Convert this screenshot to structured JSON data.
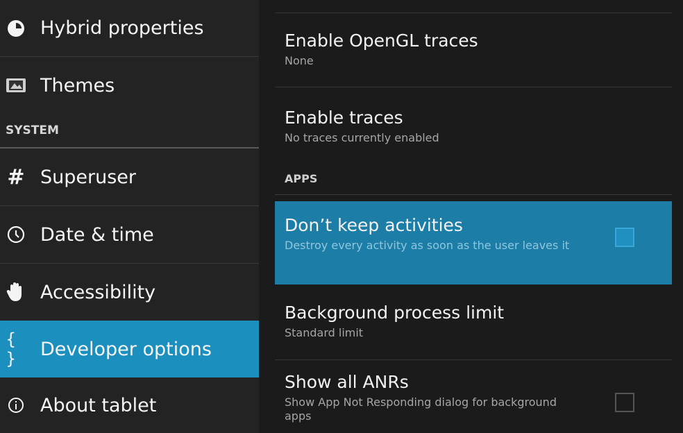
{
  "sidebar": {
    "items_top": [
      {
        "label": "Hybrid properties",
        "icon": "hybrid-icon"
      },
      {
        "label": "Themes",
        "icon": "themes-icon"
      }
    ],
    "section_system": "SYSTEM",
    "items_system": [
      {
        "label": "Superuser",
        "icon": "hash-icon"
      },
      {
        "label": "Date & time",
        "icon": "clock-icon"
      },
      {
        "label": "Accessibility",
        "icon": "hand-icon"
      },
      {
        "label": "Developer options",
        "icon": "braces-icon",
        "active": true
      },
      {
        "label": "About tablet",
        "icon": "info-icon"
      }
    ]
  },
  "main": {
    "prefs_top": [
      {
        "title": "Enable OpenGL traces",
        "summary": "None"
      },
      {
        "title": "Enable traces",
        "summary": "No traces currently enabled"
      }
    ],
    "section_apps": "APPS",
    "prefs_apps": [
      {
        "title": "Don’t keep activities",
        "summary": "Destroy every activity as soon as the user leaves it",
        "checked": false,
        "highlighted": true
      },
      {
        "title": "Background process limit",
        "summary": "Standard limit"
      },
      {
        "title": "Show all ANRs",
        "summary": "Show App Not Responding dialog for background apps",
        "checked": false
      }
    ]
  },
  "colors": {
    "accent": "#1b8fbd",
    "highlight_row": "#1c7ea7"
  }
}
